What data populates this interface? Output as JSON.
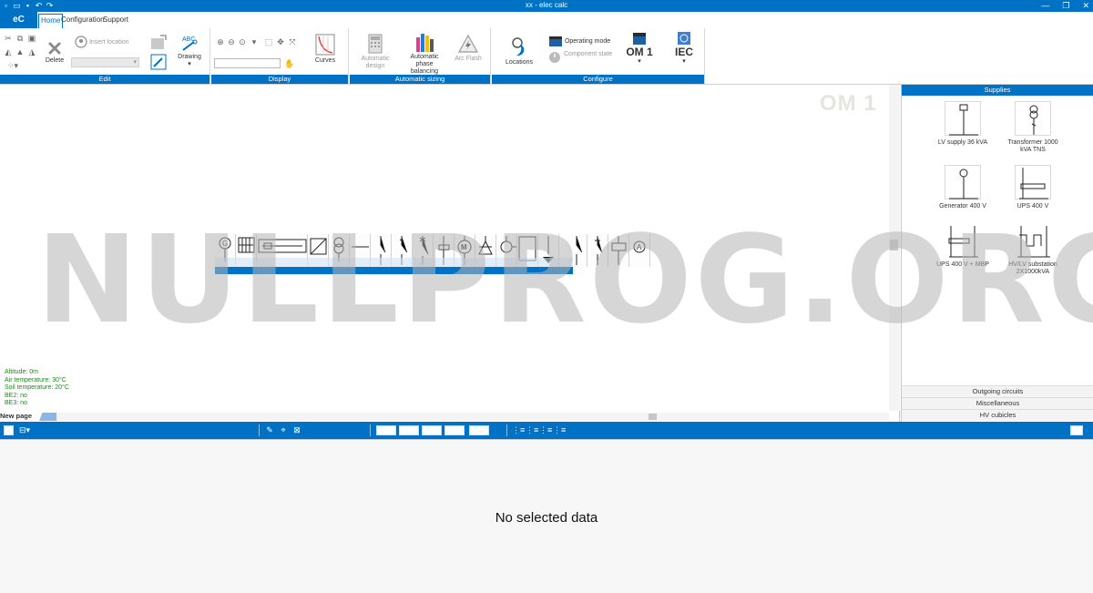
{
  "window": {
    "title": "xx - elec calc"
  },
  "app_logo": "eC",
  "tabs": [
    "Home",
    "Configuration",
    "Support"
  ],
  "ribbon": {
    "edit": {
      "label": "Edit",
      "insert_location": "Insert location",
      "delete": "Delete",
      "drawing": "Drawing"
    },
    "display": {
      "label": "Display",
      "curves": "Curves"
    },
    "sizing": {
      "label": "Automatic sizing",
      "auto_design": "Automatic design",
      "phase_balancing": "Automatic phase balancing",
      "arc_flash": "Arc Flash"
    },
    "configure": {
      "label": "Configure",
      "locations": "Locations",
      "operating_mode": "Operating mode",
      "component_state": "Component state",
      "om": "OM 1",
      "standard": "IEC"
    }
  },
  "canvas": {
    "operating_mode_label": "OM 1",
    "page_tab": "New page",
    "environment": [
      "Altitude: 0m",
      "Air temperature: 30°C",
      "Soil temperature: 20°C",
      "BE2: no",
      "BE3: no"
    ]
  },
  "supplies_panel": {
    "title": "Supplies",
    "items": [
      {
        "label": "LV supply 36 kVA"
      },
      {
        "label": "Transformer 1000 kVA TNS"
      },
      {
        "label": "Generator 400 V"
      },
      {
        "label": "UPS 400 V"
      },
      {
        "label": "UPS 400 V + MBP"
      },
      {
        "label": "HV/LV substation 2X1000kVA"
      }
    ],
    "footers": [
      "Outgoing circuits",
      "Miscellaneous",
      "HV cubicles"
    ]
  },
  "data_panel": {
    "empty_message": "No selected data"
  },
  "watermark": "NULLPROG.ORG",
  "colors": {
    "accent": "#0072c6",
    "env_text": "#1a8a1a"
  }
}
